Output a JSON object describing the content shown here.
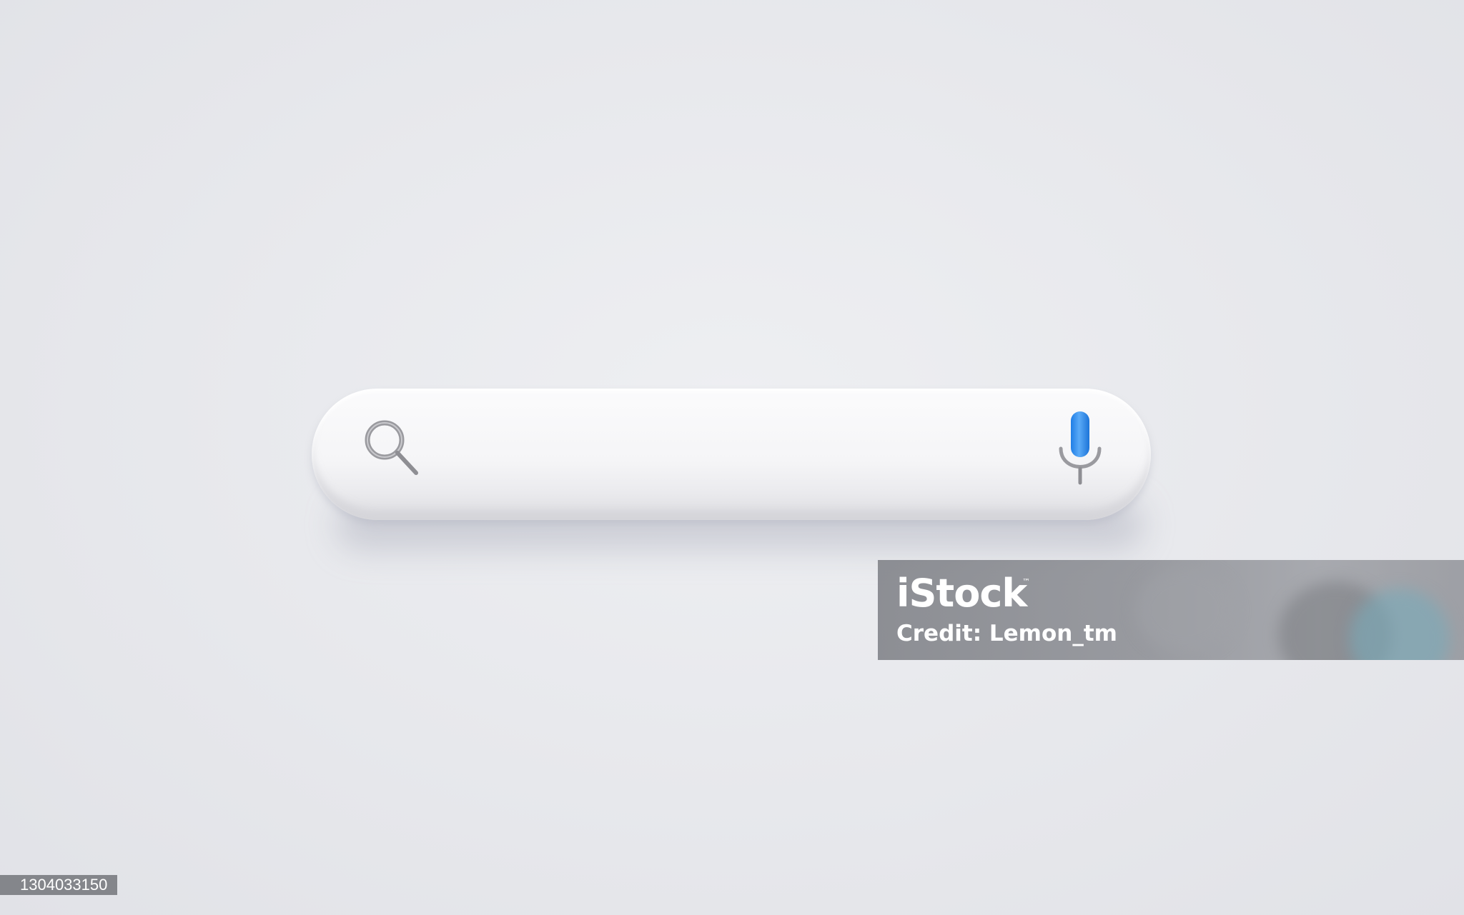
{
  "search": {
    "placeholder": "",
    "value": "",
    "icons": {
      "search": "search-icon",
      "voice": "microphone-icon"
    },
    "colors": {
      "bar": "#f6f6f8",
      "search_icon": "#8e8e93",
      "mic_capsule": "#2f8ff0",
      "mic_stand": "#8e8e93"
    }
  },
  "watermark": {
    "brand": "iStock",
    "trademark": "™",
    "credit": "Credit: Lemon_tm"
  },
  "image_id": "1304033150"
}
